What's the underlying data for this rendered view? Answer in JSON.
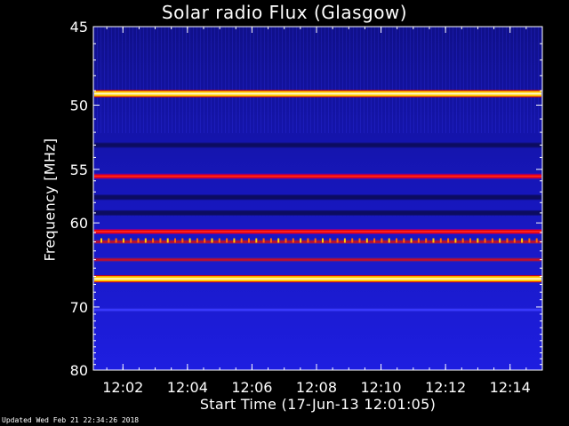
{
  "chart_data": {
    "type": "heatmap",
    "title": "Solar radio Flux (Glasgow)",
    "ylabel": "Frequency [MHz]",
    "xlabel": "Start Time (17-Jun-13 12:01:05)",
    "footer": "Updated Wed Feb 21 22:34:26 2018",
    "ylim": [
      45,
      80
    ],
    "y_ticks": [
      45,
      50,
      55,
      60,
      70,
      80
    ],
    "y_scale": "reciprocal",
    "xlim": [
      "12:01:05",
      "12:15:00"
    ],
    "x_ticks": [
      "12:02",
      "12:04",
      "12:06",
      "12:08",
      "12:10",
      "12:12",
      "12:14"
    ],
    "colormap": [
      "#0a0a6e",
      "#1a1ad8",
      "#ff0000",
      "#ffcc00",
      "#ffffe0"
    ],
    "background_color": "#1818c8",
    "bands": [
      {
        "freq": 49.2,
        "level": "very-high"
      },
      {
        "freq": 55.6,
        "level": "high"
      },
      {
        "freq": 60.9,
        "level": "high"
      },
      {
        "freq": 62.0,
        "level": "medium"
      },
      {
        "freq": 64.0,
        "level": "medium"
      },
      {
        "freq": 66.3,
        "level": "very-high"
      },
      {
        "freq": 53.0,
        "level": "low"
      },
      {
        "freq": 57.5,
        "level": "low"
      },
      {
        "freq": 59.0,
        "level": "low"
      },
      {
        "freq": 70.4,
        "level": "faint"
      }
    ]
  }
}
